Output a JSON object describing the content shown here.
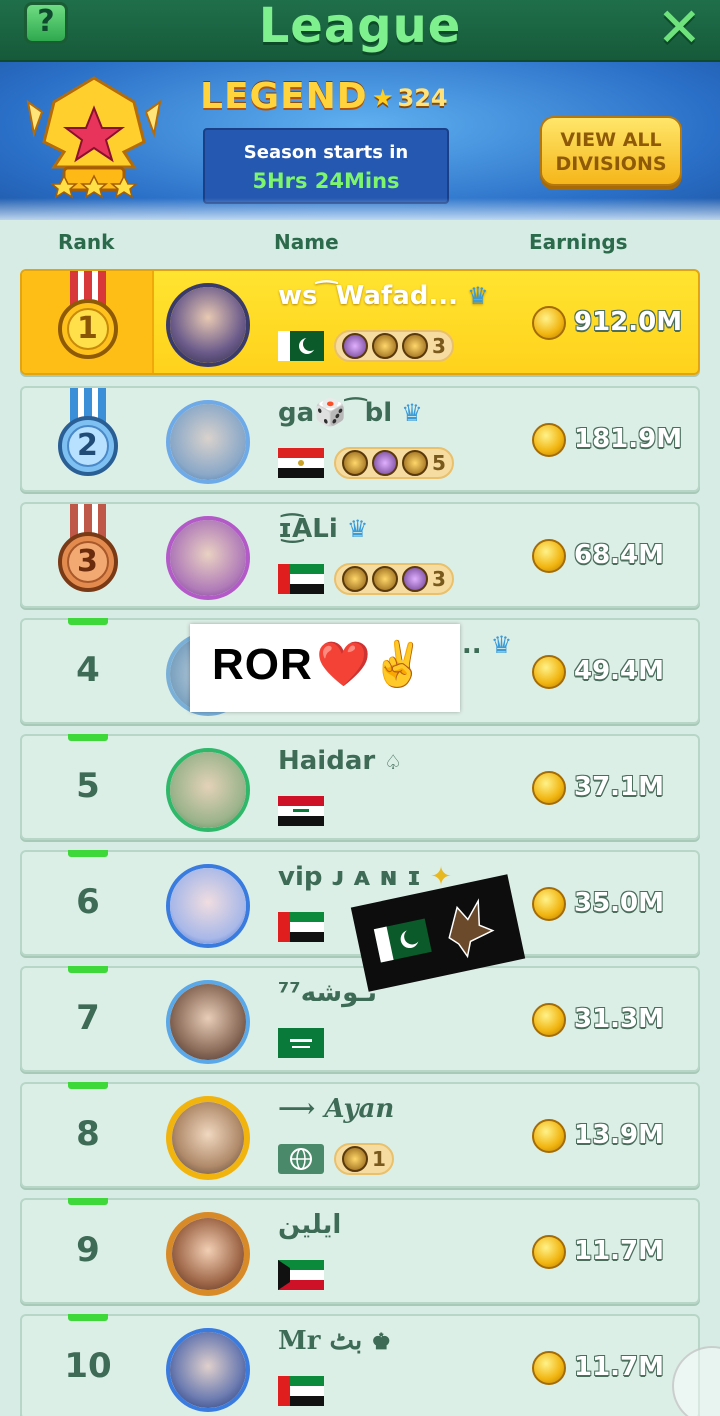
{
  "header": {
    "help_label": "?",
    "title": "League",
    "close_label": "✕"
  },
  "banner": {
    "tier": "LEGEND",
    "star_icon": "★",
    "stars": "324",
    "season_line1": "Season starts in",
    "season_line2": "5Hrs 24Mins",
    "view_all_label": "VIEW ALL DIVISIONS"
  },
  "columns": {
    "rank": "Rank",
    "name": "Name",
    "earnings": "Earnings"
  },
  "rows": [
    {
      "rank": "1",
      "name": "ws ͡ Wafad...",
      "flag": "Pakistan",
      "badge_count": "3",
      "earnings": "912.0M"
    },
    {
      "rank": "2",
      "name": "ga🎲 ͡ bl",
      "flag": "Egypt",
      "badge_count": "5",
      "earnings": "181.9M"
    },
    {
      "rank": "3",
      "name": "ɪ͜͡ALi",
      "flag": "UAE",
      "badge_count": "3",
      "earnings": "68.4M"
    },
    {
      "rank": "4",
      "name": "...",
      "flag": "",
      "badge_count": "",
      "earnings": "49.4M"
    },
    {
      "rank": "5",
      "name": "Haidar",
      "flag": "Iraq",
      "badge_count": "",
      "earnings": "37.1M"
    },
    {
      "rank": "6",
      "name": "vip ᴊ ᴀ ɴ ɪ",
      "flag": "UAE",
      "badge_count": "",
      "earnings": "35.0M"
    },
    {
      "rank": "7",
      "name": "نـوشه⁷⁷",
      "flag": "Saudi Arabia",
      "badge_count": "",
      "earnings": "31.3M"
    },
    {
      "rank": "8",
      "name": "Ayan",
      "flag": "Globe",
      "badge_count": "1",
      "earnings": "13.9M"
    },
    {
      "rank": "9",
      "name": "ايلين",
      "flag": "Kuwait",
      "badge_count": "",
      "earnings": "11.7M"
    },
    {
      "rank": "10",
      "name": "Mr بٹ",
      "flag": "UAE",
      "badge_count": "",
      "earnings": "11.7M"
    }
  ],
  "overlay": {
    "sticker_text": "ROR",
    "sticker_emoji": "❤️✌️"
  },
  "colors": {
    "title_green": "#7ff08e",
    "row_bg": "#dcefe7",
    "top_row_bg": "#ffe430",
    "header_text": "#2b6b4c"
  }
}
